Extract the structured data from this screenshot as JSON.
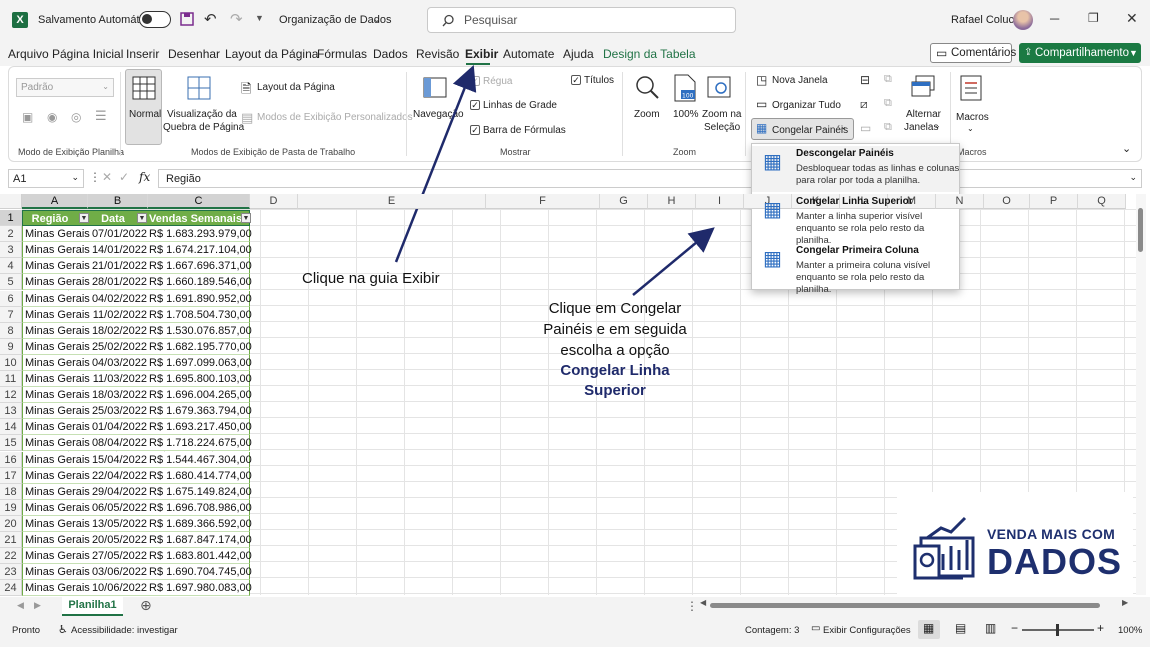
{
  "titlebar": {
    "autosave_label": "Salvamento Automático",
    "doc_name": "Organização de Dados",
    "search_placeholder": "Pesquisar",
    "user_name": "Rafael Colucci"
  },
  "menu": [
    "Arquivo",
    "Página Inicial",
    "Inserir",
    "Desenhar",
    "Layout da Página",
    "Fórmulas",
    "Dados",
    "Revisão",
    "Exibir",
    "Automate",
    "Ajuda",
    "Design da Tabela"
  ],
  "menu_active": "Exibir",
  "buttons": {
    "comments": "Comentários",
    "share": "Compartilhamento"
  },
  "ribbon": {
    "sheet_view_dropdown": "Padrão",
    "normal": "Normal",
    "page_break_1": "Visualização da",
    "page_break_2": "Quebra de Página",
    "page_layout": "Layout da Página",
    "custom_views": "Modos de Exibição Personalizados",
    "navigation": "Navegação",
    "ruler": "Régua",
    "gridlines": "Linhas de Grade",
    "formula_bar": "Barra de Fórmulas",
    "titles": "Títulos",
    "zoom": "Zoom",
    "zoom100": "100%",
    "zoom_sel_1": "Zoom na",
    "zoom_sel_2": "Seleção",
    "new_window": "Nova Janela",
    "arrange_all": "Organizar Tudo",
    "freeze_panes": "Congelar Painéis",
    "switch_1": "Alternar",
    "switch_2": "Janelas",
    "macros": "Macros",
    "groups": {
      "sheet_view": "Modo de Exibição Planilha",
      "workbook_views": "Modos de Exibição de Pasta de Trabalho",
      "show": "Mostrar",
      "zoom": "Zoom",
      "macros": "Macros"
    }
  },
  "formula": {
    "name_box": "A1",
    "fx": "fx",
    "content": "Região"
  },
  "columns": [
    "A",
    "B",
    "C",
    "D",
    "E",
    "F",
    "G",
    "H",
    "I",
    "J",
    "K",
    "L",
    "M",
    "N",
    "O",
    "P",
    "Q"
  ],
  "table": {
    "headers": [
      "Região",
      "Data",
      "Vendas Semanais"
    ],
    "rows": [
      [
        "Minas Gerais",
        "07/01/2022",
        "R$  1.683.293.979,00"
      ],
      [
        "Minas Gerais",
        "14/01/2022",
        "R$  1.674.217.104,00"
      ],
      [
        "Minas Gerais",
        "21/01/2022",
        "R$  1.667.696.371,00"
      ],
      [
        "Minas Gerais",
        "28/01/2022",
        "R$  1.660.189.546,00"
      ],
      [
        "Minas Gerais",
        "04/02/2022",
        "R$  1.691.890.952,00"
      ],
      [
        "Minas Gerais",
        "11/02/2022",
        "R$  1.708.504.730,00"
      ],
      [
        "Minas Gerais",
        "18/02/2022",
        "R$  1.530.076.857,00"
      ],
      [
        "Minas Gerais",
        "25/02/2022",
        "R$  1.682.195.770,00"
      ],
      [
        "Minas Gerais",
        "04/03/2022",
        "R$  1.697.099.063,00"
      ],
      [
        "Minas Gerais",
        "11/03/2022",
        "R$  1.695.800.103,00"
      ],
      [
        "Minas Gerais",
        "18/03/2022",
        "R$  1.696.004.265,00"
      ],
      [
        "Minas Gerais",
        "25/03/2022",
        "R$  1.679.363.794,00"
      ],
      [
        "Minas Gerais",
        "01/04/2022",
        "R$  1.693.217.450,00"
      ],
      [
        "Minas Gerais",
        "08/04/2022",
        "R$  1.718.224.675,00"
      ],
      [
        "Minas Gerais",
        "15/04/2022",
        "R$  1.544.467.304,00"
      ],
      [
        "Minas Gerais",
        "22/04/2022",
        "R$  1.680.414.774,00"
      ],
      [
        "Minas Gerais",
        "29/04/2022",
        "R$  1.675.149.824,00"
      ],
      [
        "Minas Gerais",
        "06/05/2022",
        "R$  1.696.708.986,00"
      ],
      [
        "Minas Gerais",
        "13/05/2022",
        "R$  1.689.366.592,00"
      ],
      [
        "Minas Gerais",
        "20/05/2022",
        "R$  1.687.847.174,00"
      ],
      [
        "Minas Gerais",
        "27/05/2022",
        "R$  1.683.801.442,00"
      ],
      [
        "Minas Gerais",
        "03/06/2022",
        "R$  1.690.704.745,00"
      ],
      [
        "Minas Gerais",
        "10/06/2022",
        "R$  1.697.980.083,00"
      ]
    ]
  },
  "row_numbers": [
    "1",
    "2",
    "3",
    "4",
    "5",
    "6",
    "7",
    "8",
    "9",
    "10",
    "11",
    "12",
    "13",
    "14",
    "15",
    "16",
    "17",
    "18",
    "19",
    "20",
    "21",
    "22",
    "23",
    "24"
  ],
  "dropdown": [
    {
      "title": "Descongelar Painéis",
      "desc": "Desbloquear todas as linhas e colunas para rolar por toda a planilha."
    },
    {
      "title": "Congelar Linha Superior",
      "desc": "Manter a linha superior visível enquanto se rola pelo resto da planilha."
    },
    {
      "title": "Congelar Primeira Coluna",
      "desc": "Manter a primeira coluna visível enquanto se rola pelo resto da planilha."
    }
  ],
  "annotations": {
    "a1": "Clique na guia Exibir",
    "a2_l1": "Clique em Congelar",
    "a2_l2": "Painéis e em seguida",
    "a2_l3": "escolha a opção",
    "a2_b1": "Congelar Linha",
    "a2_b2": "Superior"
  },
  "logo": {
    "line1": "VENDA MAIS COM",
    "line2": "DADOS"
  },
  "sheet_tab": "Planilha1",
  "status": {
    "ready": "Pronto",
    "accessibility": "Acessibilidade: investigar",
    "count": "Contagem: 3",
    "display_settings": "Exibir Configurações",
    "zoom": "100%"
  },
  "colors": {
    "excel_green": "#217346",
    "table_header": "#70ad47",
    "annotation_blue": "#1f2a6b",
    "logo_navy": "#1e2f6e"
  }
}
